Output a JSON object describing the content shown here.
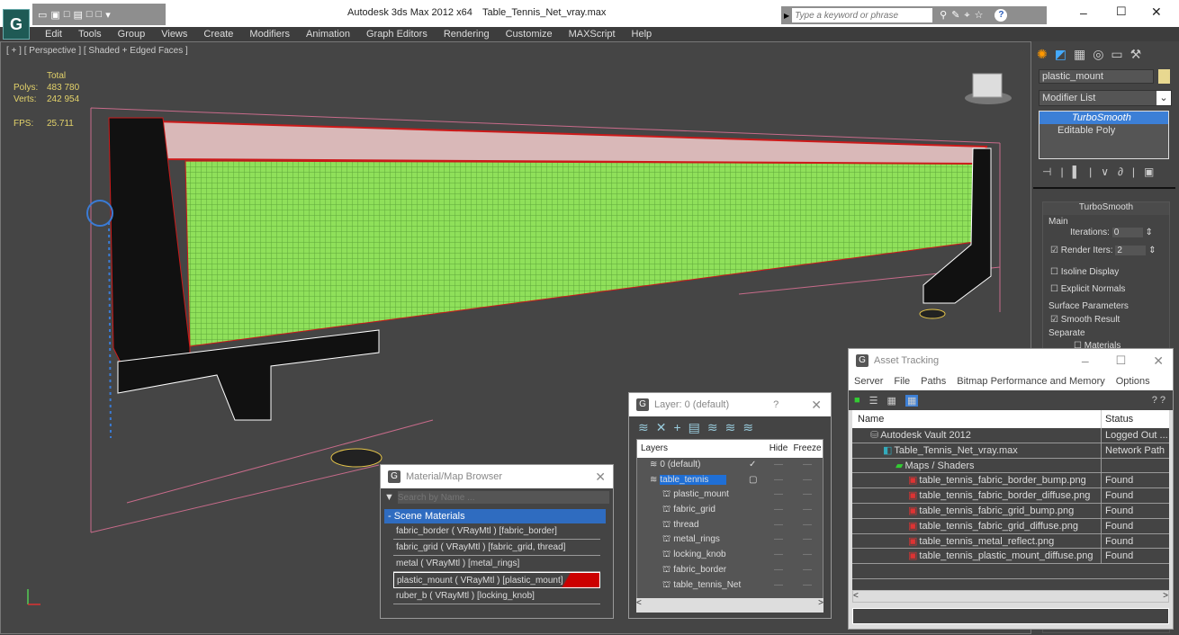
{
  "app": {
    "title": "Autodesk 3ds Max  2012 x64",
    "file": "Table_Tennis_Net_vray.max",
    "search_placeholder": "Type a keyword or phrase",
    "logo": "G"
  },
  "menu": [
    "Edit",
    "Tools",
    "Group",
    "Views",
    "Create",
    "Modifiers",
    "Animation",
    "Graph Editors",
    "Rendering",
    "Customize",
    "MAXScript",
    "Help"
  ],
  "viewport": {
    "label": "[ + ] [ Perspective ] [ Shaded + Edged Faces ]",
    "stats": {
      "total": "Total",
      "polys_label": "Polys:",
      "polys": "483 780",
      "verts_label": "Verts:",
      "verts": "242 954",
      "fps_label": "FPS:",
      "fps": "25.711"
    },
    "colors": {
      "net": "#8fe05a",
      "frame": "#cc1a1a",
      "post": "#111111"
    }
  },
  "command_panel": {
    "object_name": "plastic_mount",
    "object_color": "#e8d890",
    "modifier_list": "Modifier List",
    "stack": [
      "TurboSmooth",
      "Editable Poly"
    ],
    "rollout": "TurboSmooth",
    "main": "Main",
    "iterations_label": "Iterations:",
    "iterations": "0",
    "render_iters_label": "Render Iters:",
    "render_iters": "2",
    "render_iters_checked": true,
    "isoline": "Isoline Display",
    "explicit_normals": "Explicit Normals",
    "surface_params": "Surface Parameters",
    "smooth_result": "Smooth Result",
    "separate": "Separate",
    "materials": "Materials"
  },
  "material_browser": {
    "title": "Material/Map Browser",
    "search_placeholder": "Search by Name ...",
    "group": "- Scene Materials",
    "items": [
      "fabric_border  ( VRayMtl ) [fabric_border]",
      "fabric_grid  ( VRayMtl ) [fabric_grid, thread]",
      "metal  ( VRayMtl ) [metal_rings]",
      "plastic_mount  ( VRayMtl ) [plastic_mount]",
      "ruber_b  ( VRayMtl ) [locking_knob]"
    ],
    "selected_index": 3
  },
  "layer_dialog": {
    "title": "Layer: 0 (default)",
    "help": "?",
    "columns": [
      "Layers",
      "Hide",
      "Freeze"
    ],
    "layers": [
      {
        "name": "0 (default)",
        "level": 0,
        "current": true
      },
      {
        "name": "table_tennis",
        "level": 0,
        "selected": true
      },
      {
        "name": "plastic_mount",
        "level": 1
      },
      {
        "name": "fabric_grid",
        "level": 1
      },
      {
        "name": "thread",
        "level": 1
      },
      {
        "name": "metal_rings",
        "level": 1
      },
      {
        "name": "locking_knob",
        "level": 1
      },
      {
        "name": "fabric_border",
        "level": 1
      },
      {
        "name": "table_tennis_Net",
        "level": 1
      }
    ]
  },
  "asset_tracking": {
    "title": "Asset Tracking",
    "menu": [
      "Server",
      "File",
      "Paths",
      "Bitmap Performance and Memory",
      "Options"
    ],
    "columns": [
      "Name",
      "Status"
    ],
    "rows": [
      {
        "name": "Autodesk Vault 2012",
        "status": "Logged Out ...",
        "level": 0,
        "icon": "vault-icon"
      },
      {
        "name": "Table_Tennis_Net_vray.max",
        "status": "Network Path",
        "level": 1,
        "icon": "max-file-icon"
      },
      {
        "name": "Maps / Shaders",
        "status": "",
        "level": 2,
        "icon": "maps-icon"
      },
      {
        "name": "table_tennis_fabric_border_bump.png",
        "status": "Found",
        "level": 3,
        "icon": "png-icon"
      },
      {
        "name": "table_tennis_fabric_border_diffuse.png",
        "status": "Found",
        "level": 3,
        "icon": "png-icon"
      },
      {
        "name": "table_tennis_fabric_grid_bump.png",
        "status": "Found",
        "level": 3,
        "icon": "png-icon"
      },
      {
        "name": "table_tennis_fabric_grid_diffuse.png",
        "status": "Found",
        "level": 3,
        "icon": "png-icon"
      },
      {
        "name": "table_tennis_metal_reflect.png",
        "status": "Found",
        "level": 3,
        "icon": "png-icon"
      },
      {
        "name": "table_tennis_plastic_mount_diffuse.png",
        "status": "Found",
        "level": 3,
        "icon": "png-icon"
      }
    ]
  }
}
